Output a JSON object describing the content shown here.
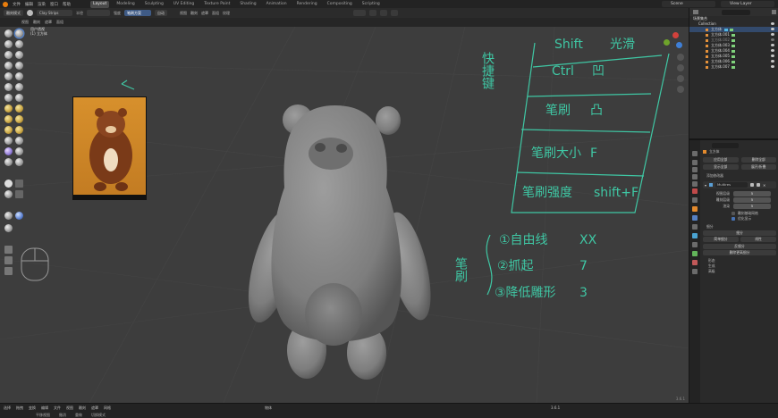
{
  "app": {
    "accent": "#4772b3",
    "viewport_bg": "#3d3d3d",
    "ink_color": "#3fc7a4"
  },
  "topbar": {
    "menu": [
      "文件",
      "编辑",
      "渲染",
      "窗口",
      "帮助"
    ],
    "workspaces": [
      "Layout",
      "Modeling",
      "Sculpting",
      "UV Editing",
      "Texture Paint",
      "Shading",
      "Animation",
      "Rendering",
      "Compositing",
      "Scripting"
    ],
    "active_workspace": "Layout",
    "scene": "Scene",
    "view_layer": "View Layer"
  },
  "header": {
    "mode": "雕刻模式",
    "brush": "Clay Strips",
    "radius": "半径",
    "strength": "强度",
    "auto": "自动",
    "brush_btn": "笔刷方案",
    "options": [
      "视图",
      "雕刻",
      "遮罩",
      "面组",
      "选择"
    ],
    "view_label": "视图",
    "sculpt_label": "雕刻",
    "mask_label": "遮罩",
    "face_label": "面组",
    "tex_label": "纹理"
  },
  "header3": {
    "left_items": [
      "视图",
      "雕刻",
      "遮罩",
      "面组"
    ]
  },
  "viewport": {
    "info_line1": "用户透视",
    "info_line2": "(1) 立方体",
    "corner_version": "3.6.1"
  },
  "handwriting": {
    "left_vertical": "快捷键",
    "table_rows": [
      {
        "key": "Shift",
        "action": "光滑"
      },
      {
        "key": "Ctrl",
        "action": "凹"
      },
      {
        "key": "笔刷",
        "action": "凸"
      },
      {
        "key": "笔刷大小",
        "action": "F"
      },
      {
        "key": "笔刷强度",
        "action": "shift+F"
      }
    ],
    "brush_label": "笔刷",
    "brush_list": [
      {
        "name": "①自由线",
        "key": "XX"
      },
      {
        "name": "②抓起",
        "key": "7"
      },
      {
        "name": "③降低雕形",
        "key": "3"
      }
    ]
  },
  "outliner": {
    "title": "场景集合",
    "items": [
      "Collection",
      "立方体",
      "立方体.001",
      "立方体.002",
      "立方体.003",
      "立方体.004",
      "立方体.005",
      "立方体.006",
      "立方体.007"
    ],
    "selected_index": 1
  },
  "properties": {
    "object_name": "立方体",
    "btn_apply": "应用全部",
    "btn_delete": "删除全部",
    "btn_show": "显示全部",
    "btn_set": "展开/折叠",
    "add_modifier": "添加修改器",
    "modifier_name": "Multires",
    "fields": [
      {
        "label": "视图层级",
        "value": "5"
      },
      {
        "label": "雕刻层级",
        "value": "5"
      },
      {
        "label": "渲染",
        "value": "5"
      }
    ],
    "check1": "雕刻基础网格",
    "check2": "优化显示",
    "section_subdiv": "细分",
    "btn_subdiv": "细分",
    "btn_simple": "简单细分",
    "btn_linear": "线性",
    "btn_unsubdiv": "反细分",
    "btn_delete_higher": "删除更高细分",
    "section_shape": "形态",
    "section_generate": "生成",
    "section_advanced": "高级"
  },
  "status": {
    "row1": [
      "选择",
      "拖拽",
      "变换",
      "编辑",
      "文件",
      "视图",
      "雕刻",
      "遮罩",
      "网格"
    ],
    "middle": "物体",
    "right": "3.6.1",
    "row2": [
      "平移视图",
      "撤消",
      "重做",
      "切换模式"
    ]
  }
}
